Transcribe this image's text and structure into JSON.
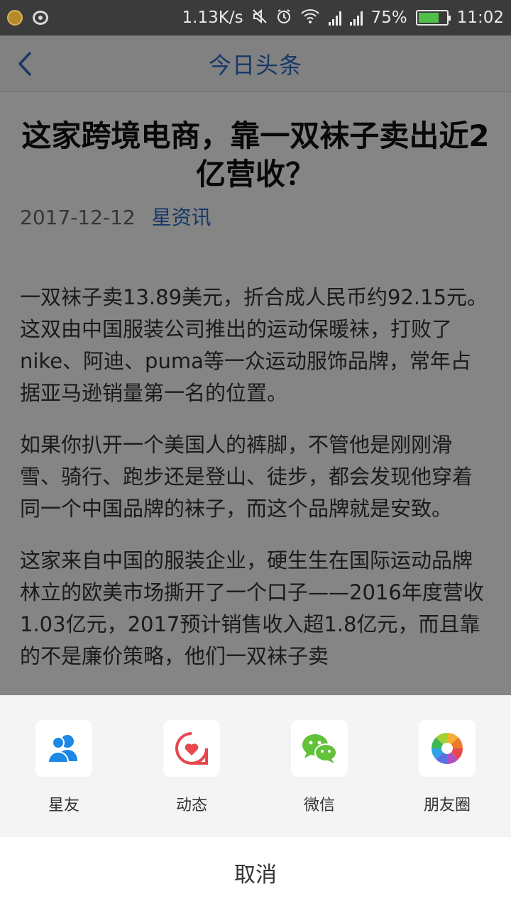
{
  "status_bar": {
    "speed": "1.13K/s",
    "battery_percent": "75%",
    "battery_level": 0.75,
    "time": "11:02",
    "icons": [
      "app-notification-icon",
      "disc-icon",
      "mute-vibrate-icon",
      "alarm-icon",
      "wifi-icon",
      "signal-icon",
      "signal-icon",
      "battery-icon"
    ]
  },
  "nav": {
    "title": "今日头条",
    "back_icon": "chevron-left-icon"
  },
  "article": {
    "title": "这家跨境电商，靠一双袜子卖出近2亿营收？",
    "date": "2017-12-12",
    "source": "星资讯",
    "paragraphs": [
      "一双袜子卖13.89美元，折合成人民币约92.15元。这双由中国服装公司推出的运动保暖袜，打败了nike、阿迪、puma等一众运动服饰品牌，常年占据亚马逊销量第一名的位置。",
      "如果你扒开一个美国人的裤脚，不管他是刚刚滑雪、骑行、跑步还是登山、徒步，都会发现他穿着同一个中国品牌的袜子，而这个品牌就是安致。",
      "这家来自中国的服装企业，硬生生在国际运动品牌林立的欧美市场撕开了一个口子——2016年度营收1.03亿元，2017预计销售收入超1.8亿元，而且靠的不是廉价策略，他们一双袜子卖"
    ]
  },
  "share": {
    "items": [
      {
        "label": "星友",
        "icon": "contacts-icon",
        "color": "#1e88e5"
      },
      {
        "label": "动态",
        "icon": "heart-bubble-icon",
        "color": "#e8474e"
      },
      {
        "label": "微信",
        "icon": "wechat-icon",
        "color": "#62c23a"
      },
      {
        "label": "朋友圈",
        "icon": "moments-aperture-icon",
        "color": "#f2b02e"
      }
    ],
    "cancel_label": "取消"
  }
}
